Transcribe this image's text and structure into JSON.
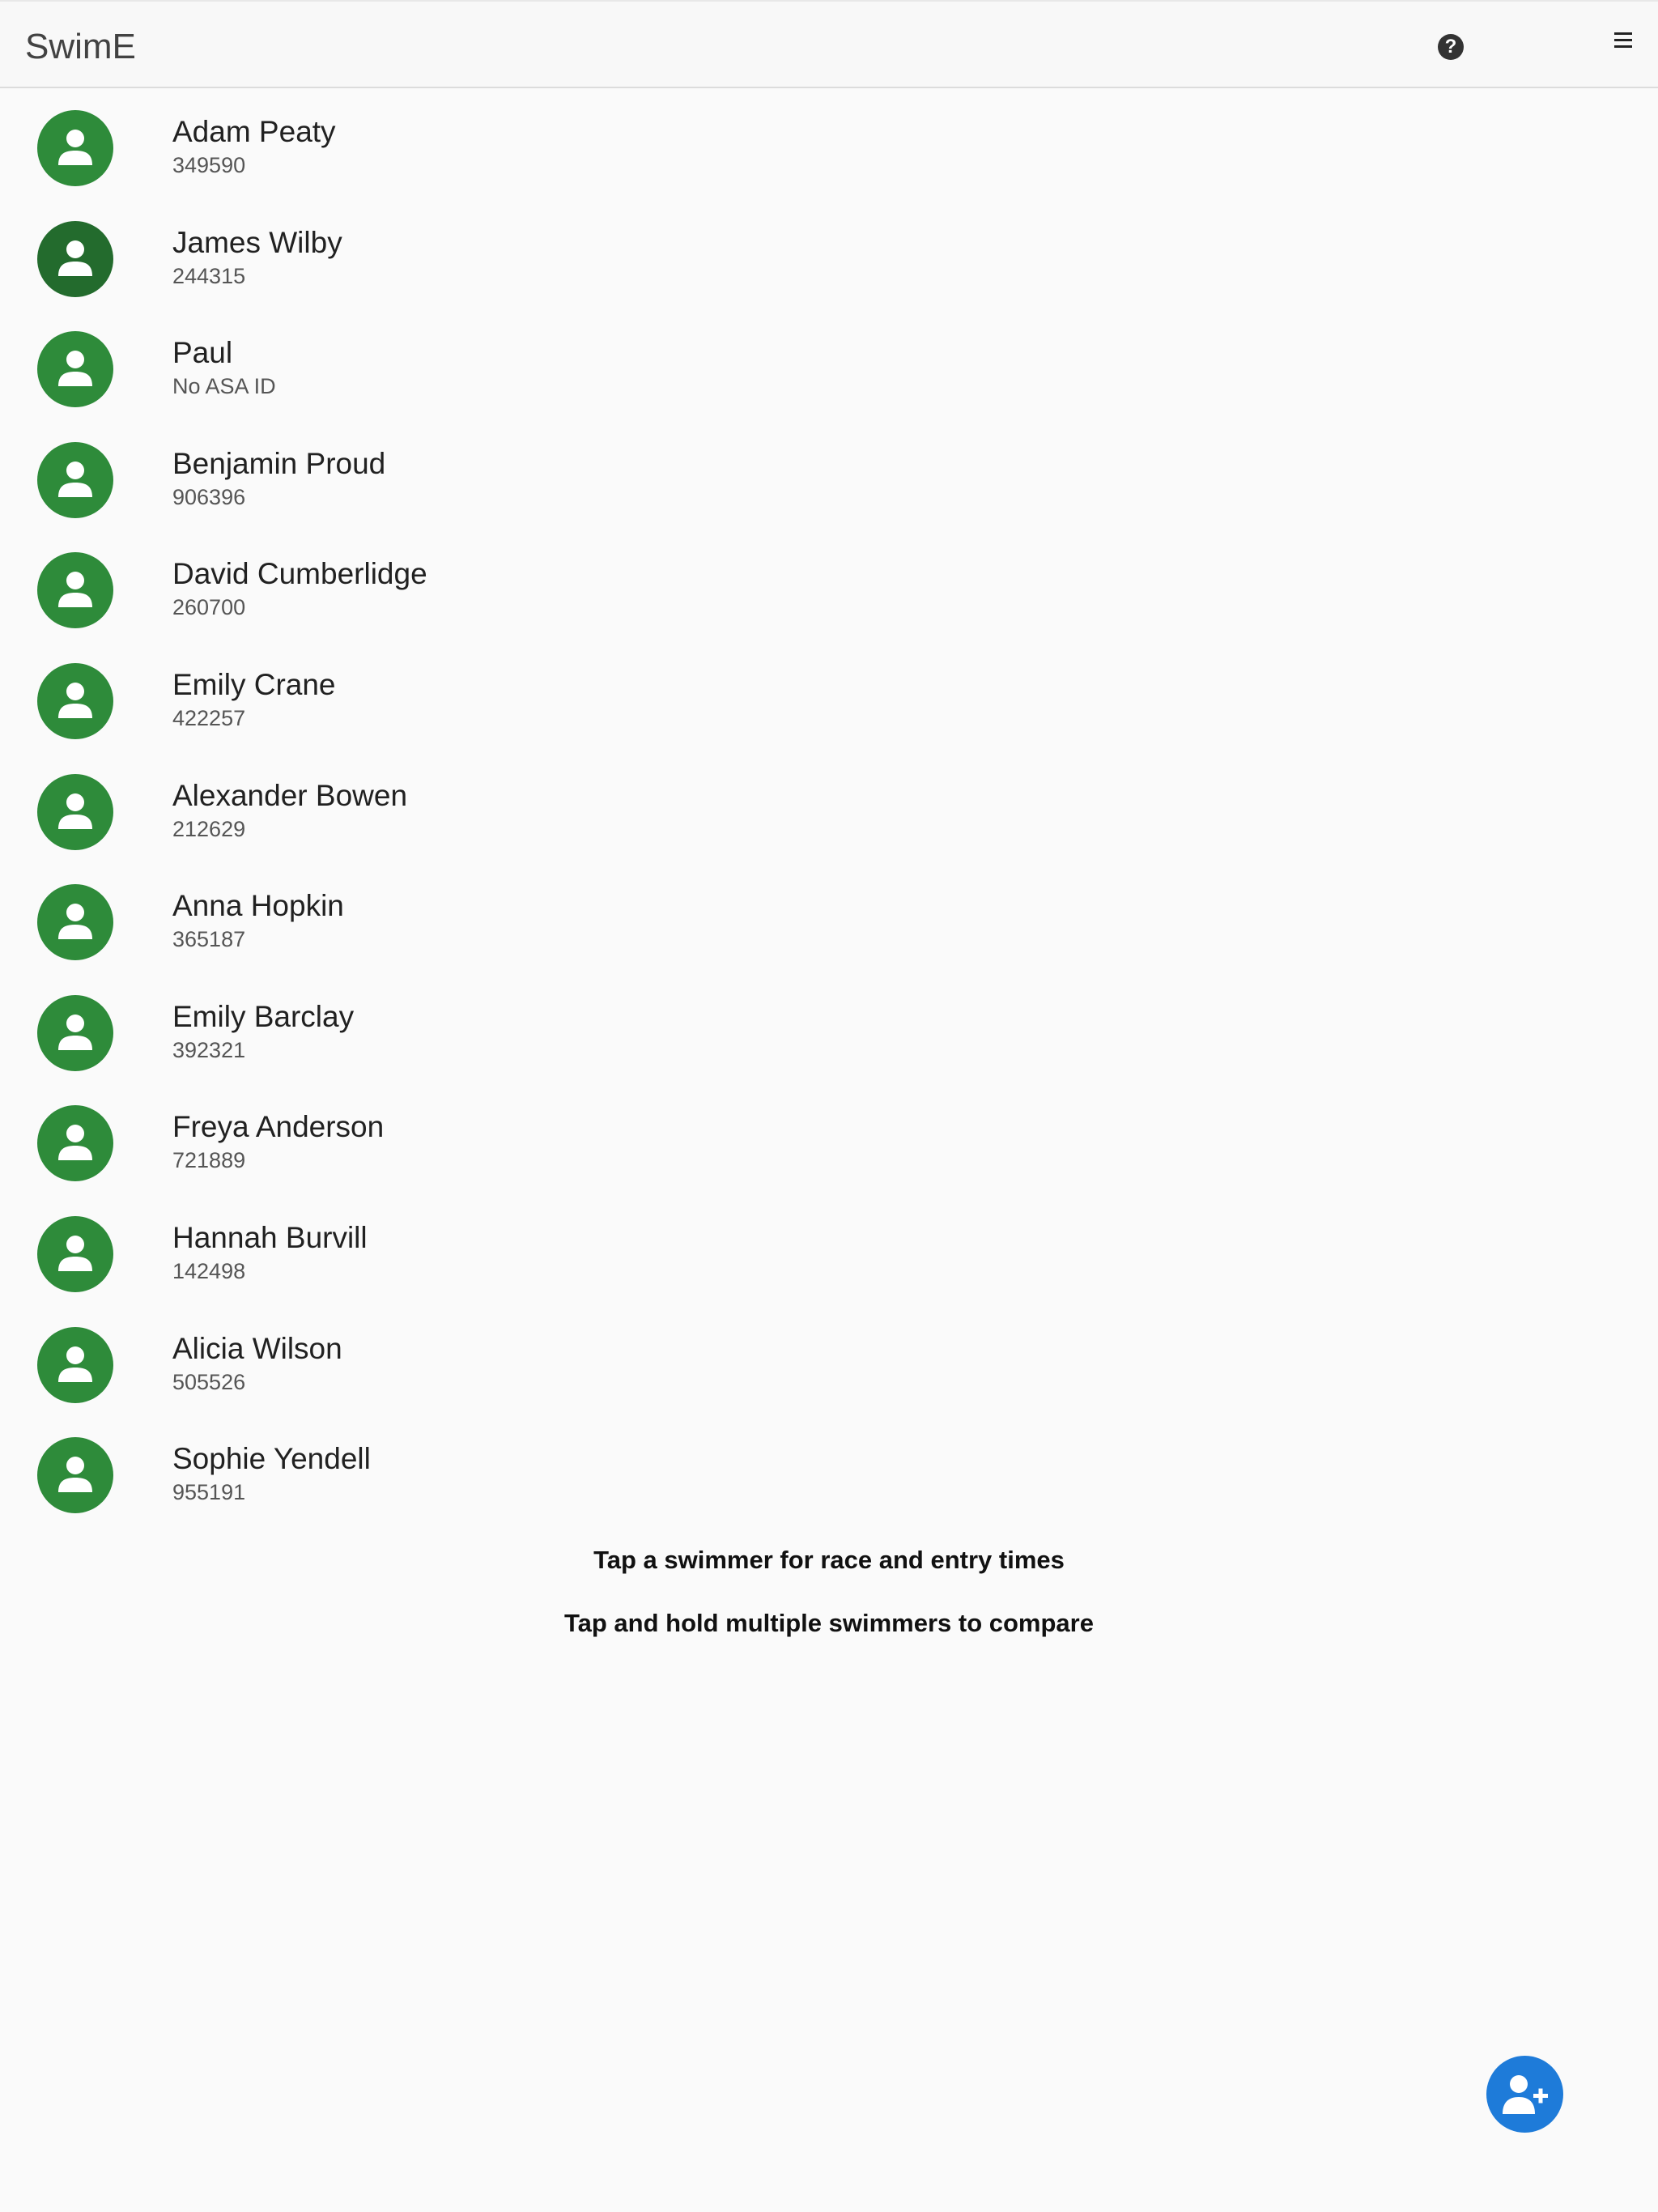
{
  "app": {
    "title": "SwimE",
    "help_icon": "help-circle-icon",
    "help_glyph": "?",
    "menu_icon": "hamburger-menu-icon"
  },
  "colors": {
    "avatar_green": "#2e8b3a",
    "avatar_green_selected": "#236b2d",
    "fab_blue": "#1e7bd9",
    "background": "#fafafa"
  },
  "swimmers": [
    {
      "name": "Adam Peaty",
      "id": "349590"
    },
    {
      "name": "James Wilby",
      "id": "244315"
    },
    {
      "name": "Paul",
      "id": "No ASA ID"
    },
    {
      "name": "Benjamin Proud",
      "id": "906396"
    },
    {
      "name": "David Cumberlidge",
      "id": "260700"
    },
    {
      "name": "Emily Crane",
      "id": "422257"
    },
    {
      "name": "Alexander Bowen",
      "id": "212629"
    },
    {
      "name": "Anna Hopkin",
      "id": "365187"
    },
    {
      "name": "Emily Barclay",
      "id": "392321"
    },
    {
      "name": "Freya Anderson",
      "id": "721889"
    },
    {
      "name": "Hannah Burvill",
      "id": "142498"
    },
    {
      "name": "Alicia Wilson",
      "id": "505526"
    },
    {
      "name": "Sophie Yendell",
      "id": "955191"
    }
  ],
  "hints": {
    "tap": "Tap a swimmer for race and entry times",
    "compare": "Tap and hold multiple swimmers to compare"
  },
  "fab": {
    "icon": "add-user-icon"
  }
}
